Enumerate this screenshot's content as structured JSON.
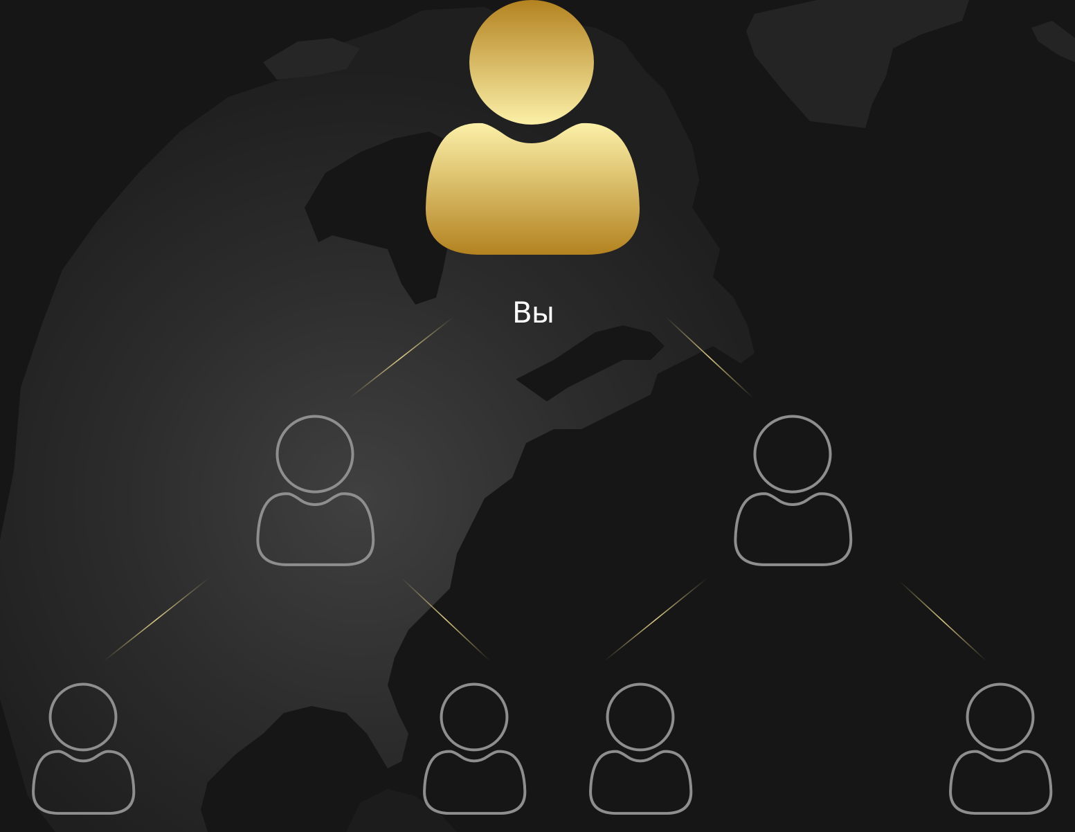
{
  "diagram": {
    "type": "referral-tree",
    "root": {
      "label": "Вы",
      "style": "filled-gold"
    },
    "levels": [
      {
        "level": 1,
        "count": 2,
        "style": "outline"
      },
      {
        "level": 2,
        "count": 4,
        "style": "outline"
      }
    ],
    "edges": [
      [
        "root",
        "l1-left"
      ],
      [
        "root",
        "l1-right"
      ],
      [
        "l1-left",
        "l2-1"
      ],
      [
        "l1-left",
        "l2-2"
      ],
      [
        "l1-right",
        "l2-3"
      ],
      [
        "l1-right",
        "l2-4"
      ]
    ]
  },
  "colors": {
    "background": "#161616",
    "map": "#2a2a2a",
    "gold_light": "#fbf0a8",
    "gold_dark": "#b38220",
    "outline": "#8e8e8e",
    "label": "#ffffff"
  },
  "icons": {
    "root": "user-icon",
    "member": "user-outline-icon"
  }
}
